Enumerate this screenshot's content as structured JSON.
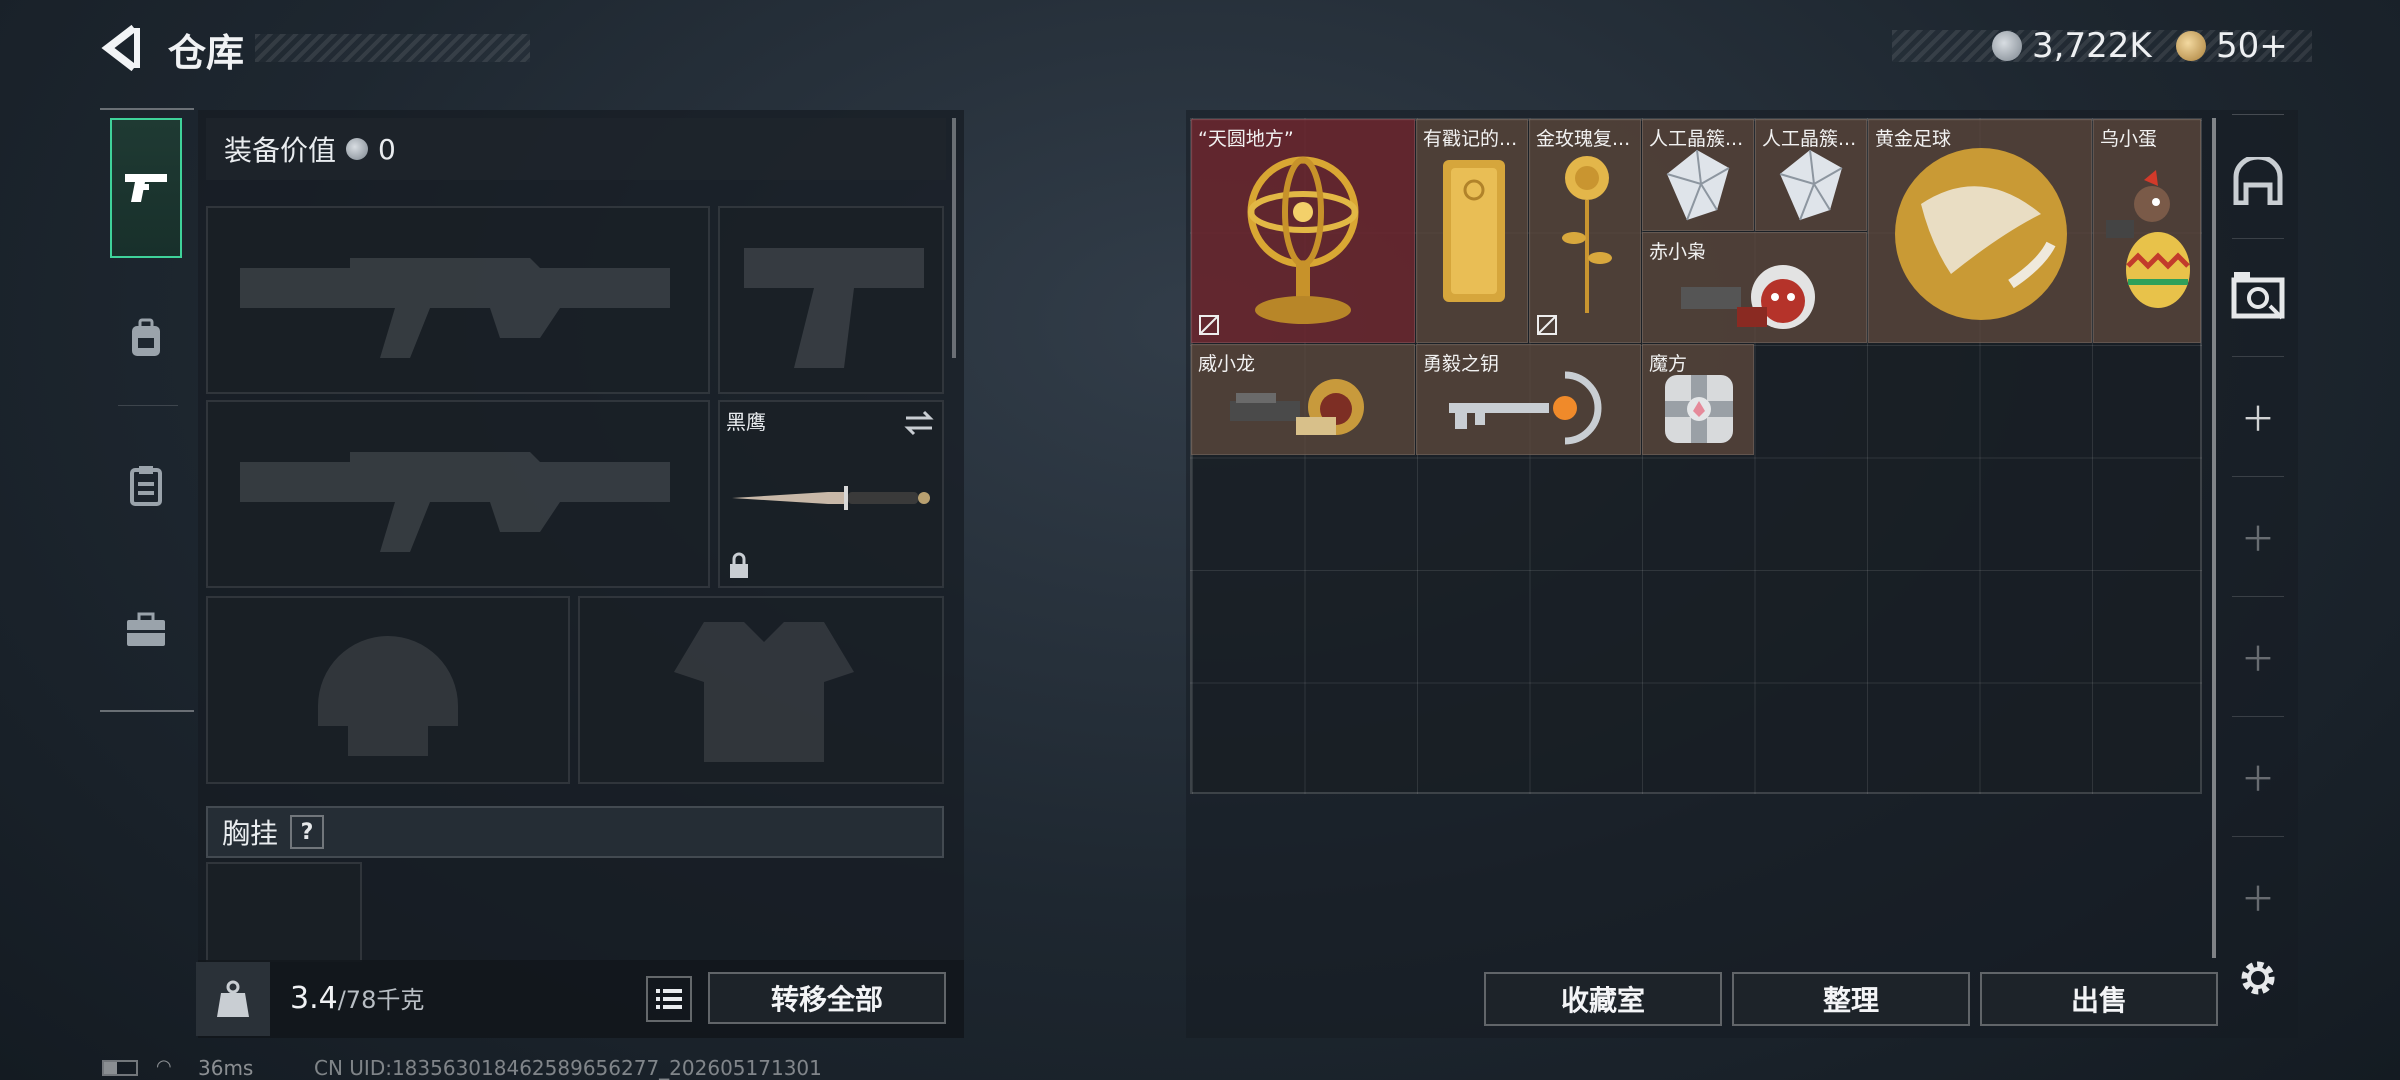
{
  "header": {
    "title": "仓库",
    "back_icon": "back-arrow-icon",
    "currency_silver": "3,722K",
    "currency_gold": "50+"
  },
  "sidebar": {
    "tabs": [
      {
        "icon": "pistol-icon",
        "active": true
      },
      {
        "icon": "backpack-icon",
        "active": false
      },
      {
        "icon": "clipboard-icon",
        "active": false
      },
      {
        "icon": "briefcase-icon",
        "active": false
      }
    ]
  },
  "equipment": {
    "value_label": "装备价值",
    "value": "0",
    "knife_label": "黑鹰",
    "chest_label": "胸挂",
    "chest_help": "?",
    "weight_current": "3.4",
    "weight_max": "/78千克",
    "transfer_all": "转移全部"
  },
  "storage": {
    "items": [
      {
        "name": "“天圆地方”"
      },
      {
        "name": "有戳记的..."
      },
      {
        "name": "金玫瑰复..."
      },
      {
        "name": "人工晶簇..."
      },
      {
        "name": "人工晶簇..."
      },
      {
        "name": "黄金足球"
      },
      {
        "name": "乌小蛋"
      },
      {
        "name": "赤小枭"
      },
      {
        "name": "威小龙"
      },
      {
        "name": "勇毅之钥"
      },
      {
        "name": "魔方"
      }
    ],
    "buttons": {
      "collection": "收藏室",
      "organize": "整理",
      "sell": "出售"
    }
  },
  "status_bar": {
    "ping": "36ms",
    "uid": "CN UID:18356301846258965627​7_202605171301"
  },
  "colors": {
    "accent": "#3fd29a",
    "item_bg": "#5c483c",
    "item_red": "#6e2830"
  }
}
